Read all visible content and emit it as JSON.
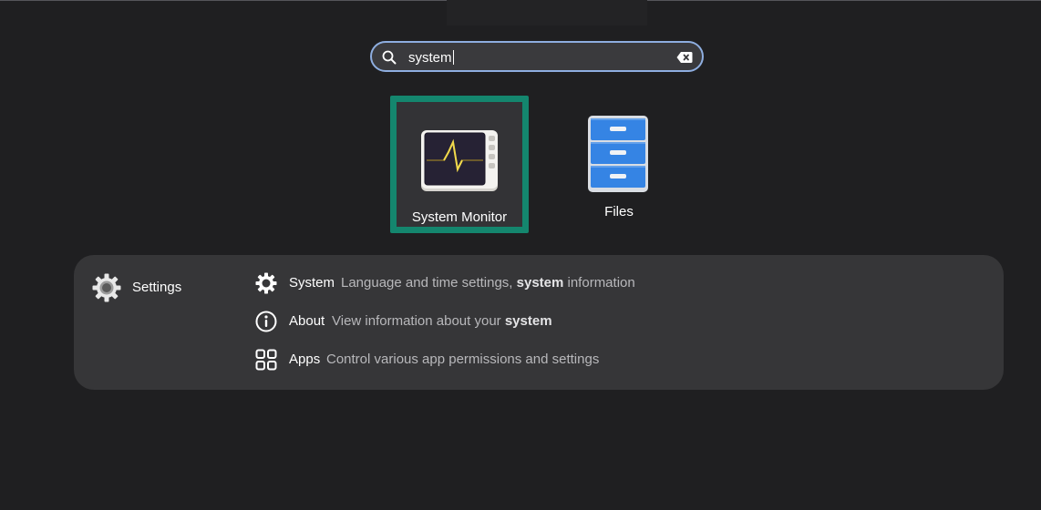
{
  "search": {
    "query": "system"
  },
  "apps": [
    {
      "name": "System Monitor",
      "icon": "system-monitor-icon",
      "selected": true
    },
    {
      "name": "Files",
      "icon": "files-icon",
      "selected": false
    }
  ],
  "provider": {
    "name": "Settings",
    "icon": "settings-gear-icon"
  },
  "results": [
    {
      "title": "System",
      "icon": "gear-icon",
      "desc_before": "Language and time settings, ",
      "desc_bold": "system",
      "desc_after": " information"
    },
    {
      "title": "About",
      "icon": "info-icon",
      "desc_before": "View information about your ",
      "desc_bold": "system",
      "desc_after": ""
    },
    {
      "title": "Apps",
      "icon": "apps-grid-icon",
      "desc_before": "Control various app permissions and settings",
      "desc_bold": "",
      "desc_after": ""
    }
  ],
  "colors": {
    "selection_border": "#14866e",
    "search_border": "#8eaee0",
    "panel_bg": "#363638",
    "background": "#1f1f21"
  }
}
